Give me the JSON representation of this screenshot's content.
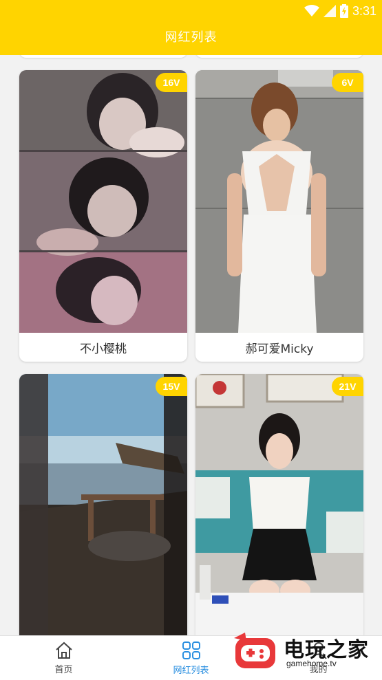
{
  "status_bar": {
    "time": "3:31"
  },
  "app_bar": {
    "title": "网红列表"
  },
  "cards": [
    {
      "name": "不小樱桃",
      "badge": "16V"
    },
    {
      "name": "郝可爱Micky",
      "badge": "6V"
    },
    {
      "name": "",
      "badge": "15V"
    },
    {
      "name": "",
      "badge": "21V"
    }
  ],
  "bottom_nav": {
    "items": [
      {
        "label": "首页",
        "icon": "home-icon",
        "active": false
      },
      {
        "label": "网红列表",
        "icon": "grid-icon",
        "active": true
      },
      {
        "label": "我的",
        "icon": "person-icon",
        "active": false
      }
    ],
    "active_color": "#2a8fe0"
  },
  "watermark": {
    "text": "电玩之家",
    "url": "gamehome.tv"
  },
  "colors": {
    "accent": "#ffd400",
    "background": "#f2f2f2"
  }
}
